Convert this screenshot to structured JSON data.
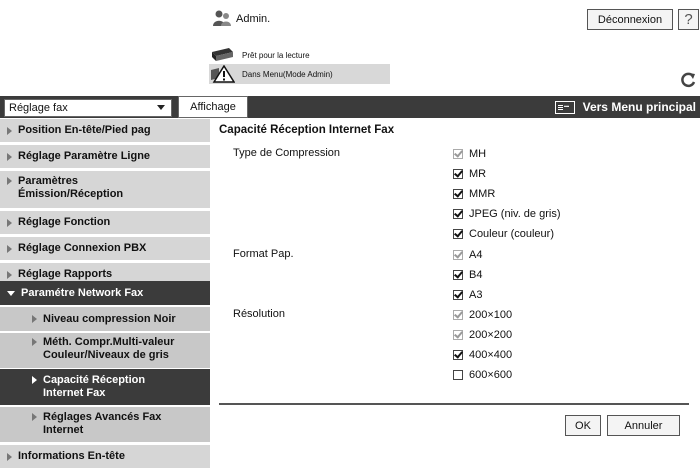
{
  "header": {
    "admin_label": "Admin.",
    "logout_label": "Déconnexion",
    "help_label": "?",
    "status_ready": "Prêt pour la lecture",
    "status_mode": "Dans Menu(Mode Admin)"
  },
  "topbar": {
    "menu_select_value": "Réglage fax",
    "display_tab": "Affichage",
    "main_menu_link": "Vers Menu principal"
  },
  "sidebar": {
    "items": [
      {
        "label": "Position En-tête/Pied pag"
      },
      {
        "label": "Réglage Paramètre Ligne"
      },
      {
        "label": "Paramètres\nÉmission/Réception"
      },
      {
        "label": "Réglage Fonction"
      },
      {
        "label": "Réglage Connexion PBX"
      },
      {
        "label": "Réglage Rapports"
      },
      {
        "label": "Paramétre Network Fax"
      },
      {
        "label": "Niveau compression Noir"
      },
      {
        "label": "Méth. Compr.Multi-valeur\nCouleur/Niveaux de gris"
      },
      {
        "label": "Capacité Réception\nInternet Fax"
      },
      {
        "label": "Réglages Avancés Fax\nInternet"
      },
      {
        "label": "Informations En-tête"
      }
    ]
  },
  "main": {
    "title": "Capacité Réception Internet Fax",
    "compression": {
      "label": "Type de Compression",
      "options": [
        {
          "label": "MH",
          "checked": true,
          "disabled": true
        },
        {
          "label": "MR",
          "checked": true,
          "disabled": false
        },
        {
          "label": "MMR",
          "checked": true,
          "disabled": false
        },
        {
          "label": "JPEG (niv. de gris)",
          "checked": true,
          "disabled": false
        },
        {
          "label": "Couleur (couleur)",
          "checked": true,
          "disabled": false
        }
      ]
    },
    "paper": {
      "label": "Format Pap.",
      "options": [
        {
          "label": "A4",
          "checked": true,
          "disabled": true
        },
        {
          "label": "B4",
          "checked": true,
          "disabled": false
        },
        {
          "label": "A3",
          "checked": true,
          "disabled": false
        }
      ]
    },
    "resolution": {
      "label": "Résolution",
      "options": [
        {
          "label": "200×100",
          "checked": true,
          "disabled": true
        },
        {
          "label": "200×200",
          "checked": true,
          "disabled": true
        },
        {
          "label": "400×400",
          "checked": true,
          "disabled": false
        },
        {
          "label": "600×600",
          "checked": false,
          "disabled": false
        }
      ]
    },
    "ok_label": "OK",
    "cancel_label": "Annuler"
  }
}
